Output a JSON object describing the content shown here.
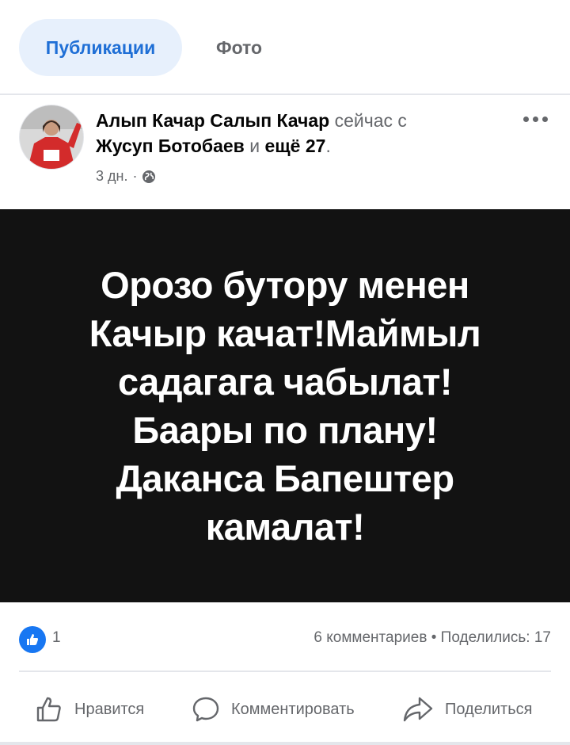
{
  "tabs": [
    {
      "label": "Публикации",
      "active": true
    },
    {
      "label": "Фото",
      "active": false
    }
  ],
  "post": {
    "author": "Алып Качар Салып Качар",
    "with_text": "сейчас с",
    "tagged": "Жусуп Ботобаев",
    "and_text": "и",
    "others": "ещё 27",
    "period": ".",
    "time": "3 дн.",
    "separator": "·",
    "privacy_icon": "globe-icon",
    "image_text": [
      "Орозо бутору менен",
      "Качыр качат!Маймыл",
      "садагага чабылат!",
      "Баары по плану!",
      "Даканса Бапештер",
      "камалат!"
    ]
  },
  "stats": {
    "likes": "1",
    "comments": "6 комментариев",
    "dot": "•",
    "shares": "Поделились: 17"
  },
  "actions": {
    "like": "Нравится",
    "comment": "Комментировать",
    "share": "Поделиться"
  },
  "colors": {
    "accent": "#1877f2",
    "tab_bg": "#e7f0fc",
    "image_bg": "#121212",
    "muted": "#65676b"
  }
}
